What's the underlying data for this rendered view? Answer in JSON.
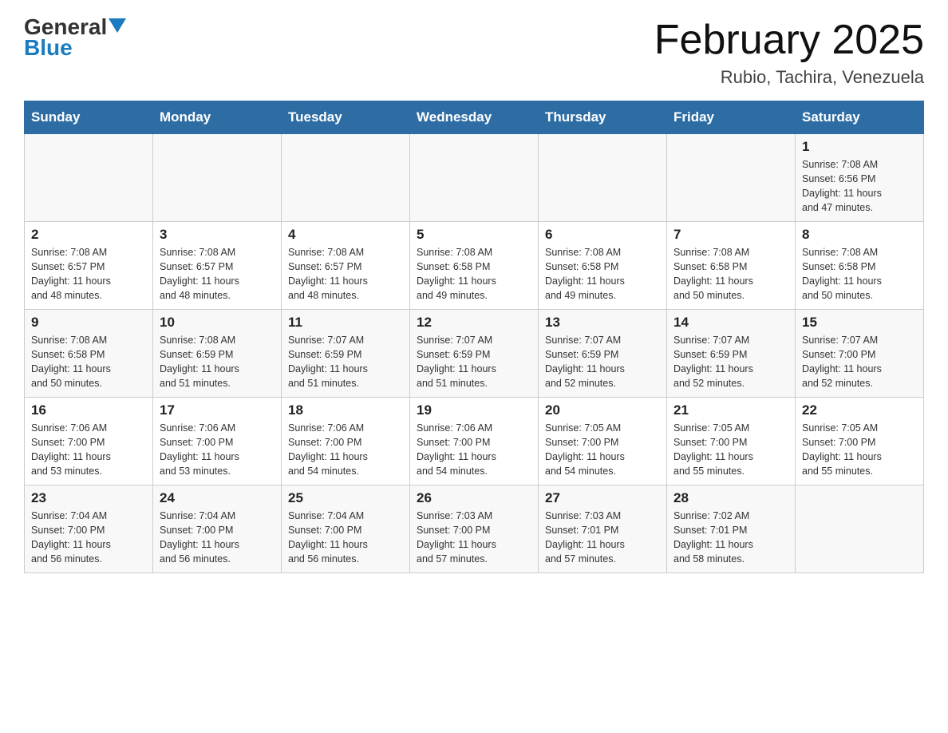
{
  "header": {
    "logo_line1": "General",
    "logo_line2": "Blue",
    "month_title": "February 2025",
    "location": "Rubio, Tachira, Venezuela"
  },
  "days_of_week": [
    "Sunday",
    "Monday",
    "Tuesday",
    "Wednesday",
    "Thursday",
    "Friday",
    "Saturday"
  ],
  "weeks": [
    [
      {
        "day": "",
        "info": ""
      },
      {
        "day": "",
        "info": ""
      },
      {
        "day": "",
        "info": ""
      },
      {
        "day": "",
        "info": ""
      },
      {
        "day": "",
        "info": ""
      },
      {
        "day": "",
        "info": ""
      },
      {
        "day": "1",
        "info": "Sunrise: 7:08 AM\nSunset: 6:56 PM\nDaylight: 11 hours\nand 47 minutes."
      }
    ],
    [
      {
        "day": "2",
        "info": "Sunrise: 7:08 AM\nSunset: 6:57 PM\nDaylight: 11 hours\nand 48 minutes."
      },
      {
        "day": "3",
        "info": "Sunrise: 7:08 AM\nSunset: 6:57 PM\nDaylight: 11 hours\nand 48 minutes."
      },
      {
        "day": "4",
        "info": "Sunrise: 7:08 AM\nSunset: 6:57 PM\nDaylight: 11 hours\nand 48 minutes."
      },
      {
        "day": "5",
        "info": "Sunrise: 7:08 AM\nSunset: 6:58 PM\nDaylight: 11 hours\nand 49 minutes."
      },
      {
        "day": "6",
        "info": "Sunrise: 7:08 AM\nSunset: 6:58 PM\nDaylight: 11 hours\nand 49 minutes."
      },
      {
        "day": "7",
        "info": "Sunrise: 7:08 AM\nSunset: 6:58 PM\nDaylight: 11 hours\nand 50 minutes."
      },
      {
        "day": "8",
        "info": "Sunrise: 7:08 AM\nSunset: 6:58 PM\nDaylight: 11 hours\nand 50 minutes."
      }
    ],
    [
      {
        "day": "9",
        "info": "Sunrise: 7:08 AM\nSunset: 6:58 PM\nDaylight: 11 hours\nand 50 minutes."
      },
      {
        "day": "10",
        "info": "Sunrise: 7:08 AM\nSunset: 6:59 PM\nDaylight: 11 hours\nand 51 minutes."
      },
      {
        "day": "11",
        "info": "Sunrise: 7:07 AM\nSunset: 6:59 PM\nDaylight: 11 hours\nand 51 minutes."
      },
      {
        "day": "12",
        "info": "Sunrise: 7:07 AM\nSunset: 6:59 PM\nDaylight: 11 hours\nand 51 minutes."
      },
      {
        "day": "13",
        "info": "Sunrise: 7:07 AM\nSunset: 6:59 PM\nDaylight: 11 hours\nand 52 minutes."
      },
      {
        "day": "14",
        "info": "Sunrise: 7:07 AM\nSunset: 6:59 PM\nDaylight: 11 hours\nand 52 minutes."
      },
      {
        "day": "15",
        "info": "Sunrise: 7:07 AM\nSunset: 7:00 PM\nDaylight: 11 hours\nand 52 minutes."
      }
    ],
    [
      {
        "day": "16",
        "info": "Sunrise: 7:06 AM\nSunset: 7:00 PM\nDaylight: 11 hours\nand 53 minutes."
      },
      {
        "day": "17",
        "info": "Sunrise: 7:06 AM\nSunset: 7:00 PM\nDaylight: 11 hours\nand 53 minutes."
      },
      {
        "day": "18",
        "info": "Sunrise: 7:06 AM\nSunset: 7:00 PM\nDaylight: 11 hours\nand 54 minutes."
      },
      {
        "day": "19",
        "info": "Sunrise: 7:06 AM\nSunset: 7:00 PM\nDaylight: 11 hours\nand 54 minutes."
      },
      {
        "day": "20",
        "info": "Sunrise: 7:05 AM\nSunset: 7:00 PM\nDaylight: 11 hours\nand 54 minutes."
      },
      {
        "day": "21",
        "info": "Sunrise: 7:05 AM\nSunset: 7:00 PM\nDaylight: 11 hours\nand 55 minutes."
      },
      {
        "day": "22",
        "info": "Sunrise: 7:05 AM\nSunset: 7:00 PM\nDaylight: 11 hours\nand 55 minutes."
      }
    ],
    [
      {
        "day": "23",
        "info": "Sunrise: 7:04 AM\nSunset: 7:00 PM\nDaylight: 11 hours\nand 56 minutes."
      },
      {
        "day": "24",
        "info": "Sunrise: 7:04 AM\nSunset: 7:00 PM\nDaylight: 11 hours\nand 56 minutes."
      },
      {
        "day": "25",
        "info": "Sunrise: 7:04 AM\nSunset: 7:00 PM\nDaylight: 11 hours\nand 56 minutes."
      },
      {
        "day": "26",
        "info": "Sunrise: 7:03 AM\nSunset: 7:00 PM\nDaylight: 11 hours\nand 57 minutes."
      },
      {
        "day": "27",
        "info": "Sunrise: 7:03 AM\nSunset: 7:01 PM\nDaylight: 11 hours\nand 57 minutes."
      },
      {
        "day": "28",
        "info": "Sunrise: 7:02 AM\nSunset: 7:01 PM\nDaylight: 11 hours\nand 58 minutes."
      },
      {
        "day": "",
        "info": ""
      }
    ]
  ]
}
